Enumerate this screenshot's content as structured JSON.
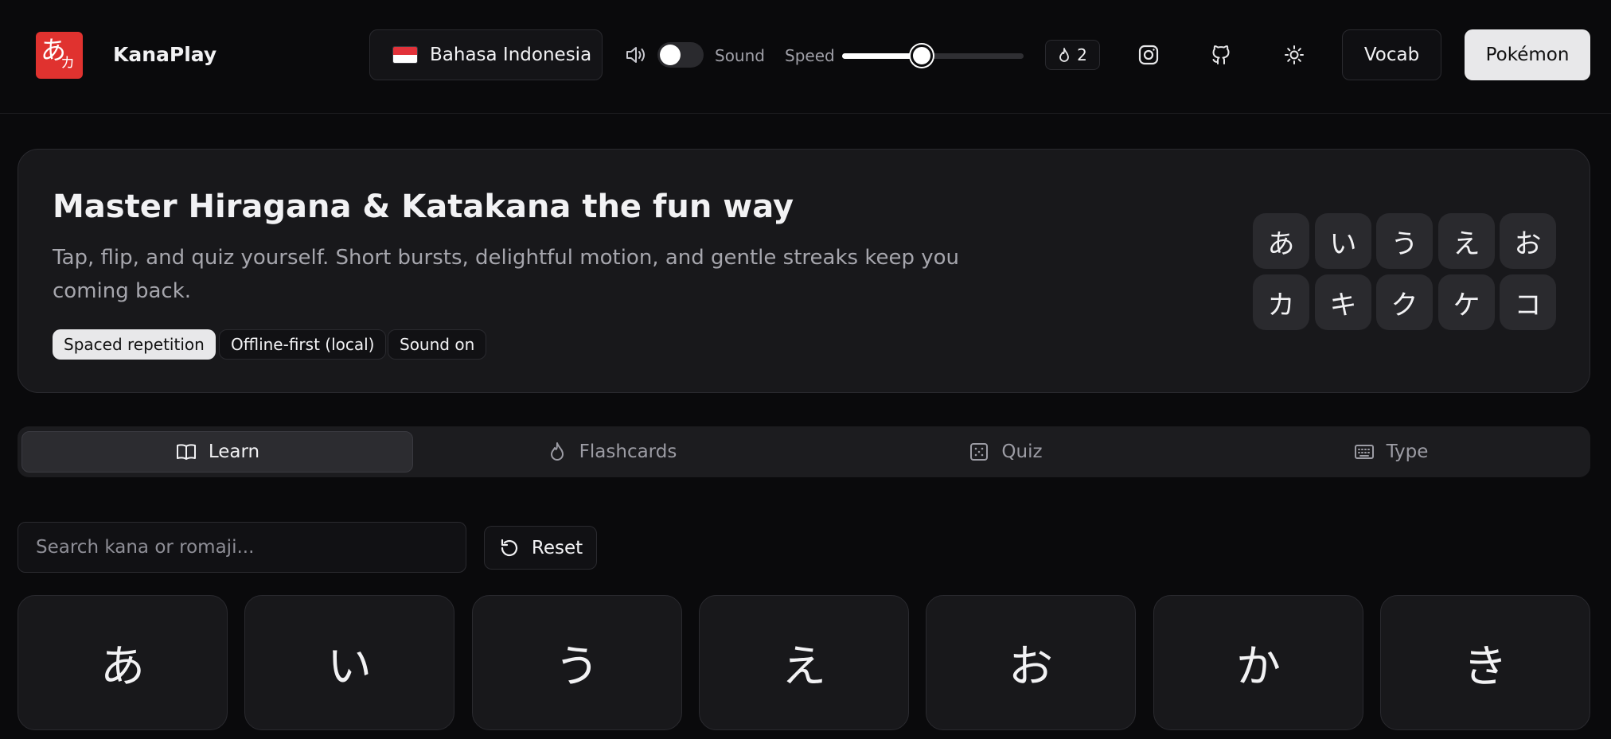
{
  "header": {
    "logo_kana": [
      "あ",
      "カ"
    ],
    "brand": "KanaPlay",
    "language": "Bahasa Indonesia",
    "sound_label": "Sound",
    "sound_on": false,
    "speed_label": "Speed",
    "speed_fraction": 0.44,
    "streak_count": "2",
    "vocab_label": "Vocab",
    "pokemon_label": "Pokémon"
  },
  "hero": {
    "title": "Master Hiragana & Katakana the fun way",
    "subtitle": "Tap, flip, and quiz yourself. Short bursts, delightful motion, and gentle streaks keep you coming back.",
    "chips": [
      "Spaced repetition",
      "Offline-first (local)",
      "Sound on"
    ],
    "kana_row1": [
      "あ",
      "い",
      "う",
      "え",
      "お"
    ],
    "kana_row2": [
      "カ",
      "キ",
      "ク",
      "ケ",
      "コ"
    ]
  },
  "tabs": [
    {
      "label": "Learn",
      "icon": "book-icon",
      "active": true
    },
    {
      "label": "Flashcards",
      "icon": "flame-icon",
      "active": false
    },
    {
      "label": "Quiz",
      "icon": "quiz-icon",
      "active": false
    },
    {
      "label": "Type",
      "icon": "keyboard-icon",
      "active": false
    }
  ],
  "search": {
    "placeholder": "Search kana or romaji...",
    "value": ""
  },
  "reset_label": "Reset",
  "kana_cards": [
    "あ",
    "い",
    "う",
    "え",
    "お",
    "か",
    "き"
  ],
  "colors": {
    "logo": "#e0322f",
    "background": "#0a0a0c",
    "card": "#18181b"
  }
}
